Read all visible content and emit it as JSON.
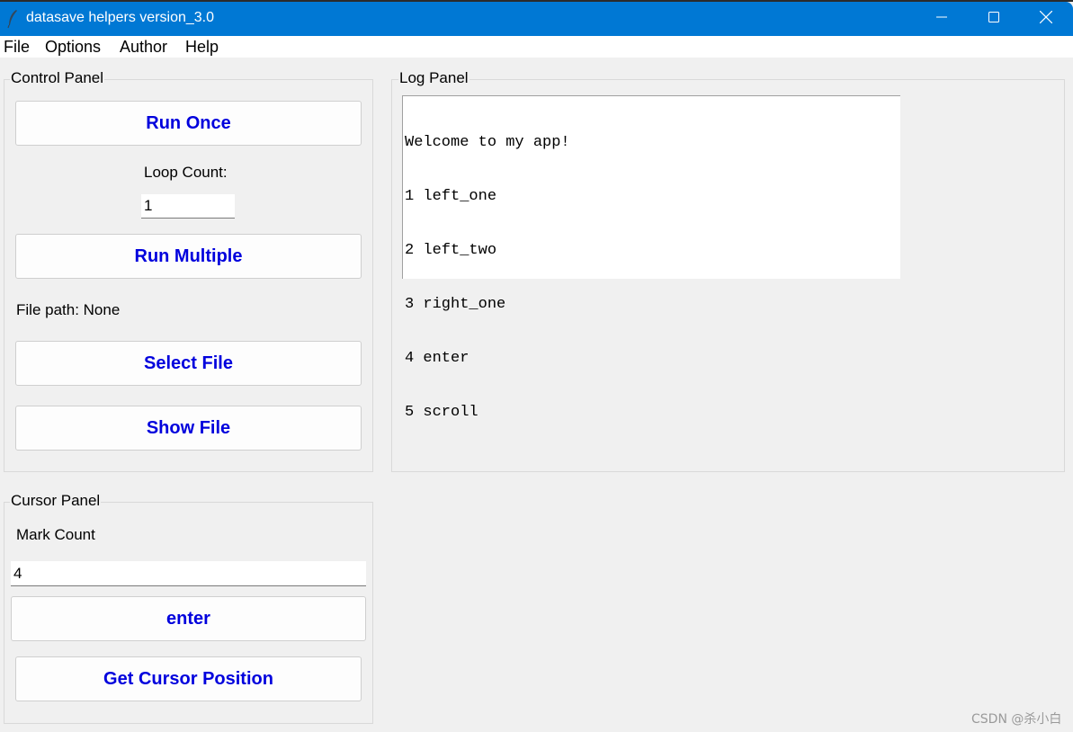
{
  "window": {
    "title": "datasave helpers version_3.0",
    "app_icon": "feather-icon",
    "controls": [
      "minimize-icon",
      "maximize-icon",
      "close-icon"
    ]
  },
  "menubar": {
    "items": [
      {
        "label": "File"
      },
      {
        "label": "Options"
      },
      {
        "label": "Author"
      },
      {
        "label": "Help"
      }
    ]
  },
  "control_panel": {
    "title": "Control Panel",
    "run_once_label": "Run Once",
    "loop_count_label": "Loop Count:",
    "loop_count_value": "1",
    "run_multiple_label": "Run Multiple",
    "file_path_text": "File path: None",
    "select_file_label": "Select File",
    "show_file_label": "Show File"
  },
  "log_panel": {
    "title": "Log Panel",
    "lines": [
      "Welcome to my app!",
      "1 left_one",
      "2 left_two",
      "3 right_one",
      "4 enter",
      "5 scroll"
    ]
  },
  "cursor_panel": {
    "title": "Cursor Panel",
    "mark_count_label": "Mark Count",
    "mark_count_value": "4",
    "enter_label": "enter",
    "get_cursor_label": "Get Cursor Position"
  },
  "watermark": "CSDN @杀小白",
  "colors": {
    "titlebar": "#0078d4",
    "button_text": "#0000dd",
    "background": "#f0f0f0"
  }
}
